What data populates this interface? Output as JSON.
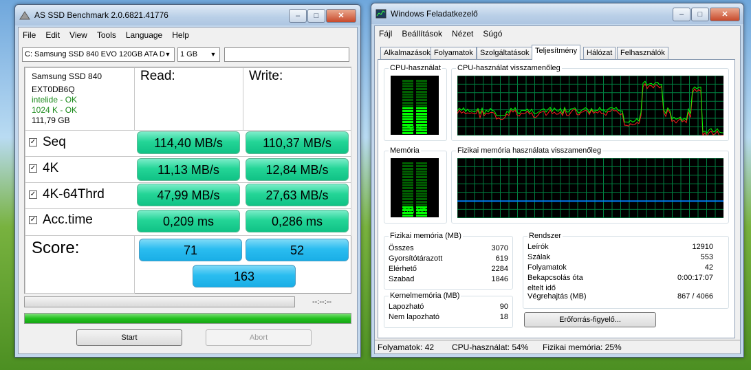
{
  "asssd": {
    "title": "AS SSD Benchmark 2.0.6821.41776",
    "menu": [
      "File",
      "Edit",
      "View",
      "Tools",
      "Language",
      "Help"
    ],
    "drive_select": "C: Samsung SSD 840 EVO 120GB ATA D",
    "size_select": "1 GB",
    "info": {
      "model": "Samsung SSD 840",
      "firmware": "EXT0DB6Q",
      "driver": "intelide - OK",
      "align": "1024 K - OK",
      "capacity": "111,79 GB"
    },
    "headers": {
      "read": "Read:",
      "write": "Write:"
    },
    "tests": [
      {
        "label": "Seq",
        "checked": true,
        "read": "114,40 MB/s",
        "write": "110,37 MB/s"
      },
      {
        "label": "4K",
        "checked": true,
        "read": "11,13 MB/s",
        "write": "12,84 MB/s"
      },
      {
        "label": "4K-64Thrd",
        "checked": true,
        "read": "47,99 MB/s",
        "write": "27,63 MB/s"
      },
      {
        "label": "Acc.time",
        "checked": true,
        "read": "0,209 ms",
        "write": "0,286 ms"
      }
    ],
    "score": {
      "label": "Score:",
      "read": "71",
      "write": "52",
      "total": "163"
    },
    "timer": "--:--:--",
    "progress_top": 0,
    "progress_bottom": 1.0,
    "start_label": "Start",
    "abort_label": "Abort",
    "progress_color": "#22c11f",
    "read_color": "#24d597",
    "score_color": "#2bbdf0"
  },
  "taskmgr": {
    "title": "Windows Feladatkezelő",
    "menu": [
      "Fájl",
      "Beállítások",
      "Nézet",
      "Súgó"
    ],
    "tabs": [
      "Alkalmazások",
      "Folyamatok",
      "Szolgáltatások",
      "Teljesítmény",
      "Hálózat",
      "Felhasználók"
    ],
    "active_tab": "Teljesítmény",
    "cpu_label": "CPU-használat",
    "cpu_value": "54 %",
    "cpu_level": 0.54,
    "cpu_history_label": "CPU-használat visszamenőleg",
    "mem_label": "Memória",
    "mem_value": "786 MB",
    "mem_level": 0.26,
    "mem_history_label": "Fizikai memória használata visszamenőleg",
    "physical": {
      "title": "Fizikai memória (MB)",
      "rows": [
        [
          "Összes",
          "3070"
        ],
        [
          "Gyorsítótárazott",
          "619"
        ],
        [
          "Elérhető",
          "2284"
        ],
        [
          "Szabad",
          "1846"
        ]
      ]
    },
    "kernel": {
      "title": "Kernelmemória (MB)",
      "rows": [
        [
          "Lapozható",
          "90"
        ],
        [
          "Nem lapozható",
          "18"
        ]
      ]
    },
    "system": {
      "title": "Rendszer",
      "rows": [
        [
          "Leírók",
          "12910"
        ],
        [
          "Szálak",
          "553"
        ],
        [
          "Folyamatok",
          "42"
        ],
        [
          "Bekapcsolás óta eltelt idő",
          "0:00:17:07"
        ],
        [
          "Végrehajtás (MB)",
          "867 / 4066"
        ]
      ]
    },
    "resmon_label": "Erőforrás-figyelő...",
    "status": {
      "processes": "Folyamatok: 42",
      "cpu": "CPU-használat: 54%",
      "memory": "Fizikai memória: 25%"
    },
    "gauge_color": "#00ff00",
    "grid_color": "#008040",
    "cpu_line_color": "#00ff00",
    "mem_line_color": "#0080ff"
  }
}
